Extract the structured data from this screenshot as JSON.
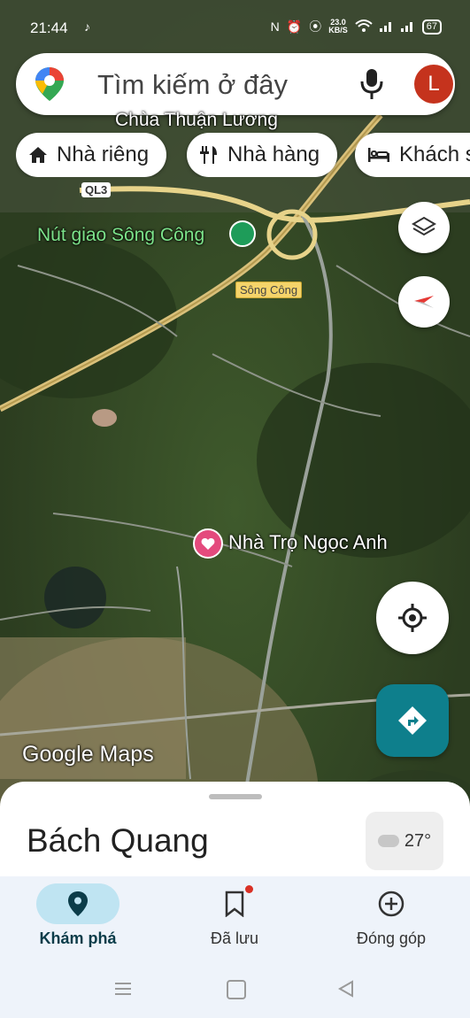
{
  "status_bar": {
    "time": "21:44",
    "speed_value": "23.0",
    "speed_unit": "KB/S",
    "battery": "67"
  },
  "search": {
    "placeholder": "Tìm kiếm ở đây",
    "avatar_letter": "L"
  },
  "chips": [
    {
      "label": "Nhà riêng",
      "icon": "home-icon"
    },
    {
      "label": "Nhà hàng",
      "icon": "restaurant-icon"
    },
    {
      "label": "Khách sạn",
      "icon": "hotel-icon"
    }
  ],
  "map": {
    "poi_top": "Chùa Thuận Lương",
    "highway_shield": "QL3",
    "interchange_label": "Nút giao Sông Công",
    "road_label": "Sông Công",
    "place_pin_label": "Nhà Trọ Ngọc Anh",
    "watermark": "Google Maps"
  },
  "sheet": {
    "title": "Bách Quang",
    "temperature": "27°"
  },
  "nav": [
    {
      "label": "Khám phá",
      "icon": "explore-pin-icon",
      "active": true
    },
    {
      "label": "Đã lưu",
      "icon": "bookmark-icon",
      "active": false
    },
    {
      "label": "Đóng góp",
      "icon": "add-circle-icon",
      "active": false
    }
  ],
  "colors": {
    "accent": "#0e7f8c",
    "pin": "#e44a7d",
    "avatar": "#c5331d",
    "nav_active": "#bfe4f2"
  }
}
